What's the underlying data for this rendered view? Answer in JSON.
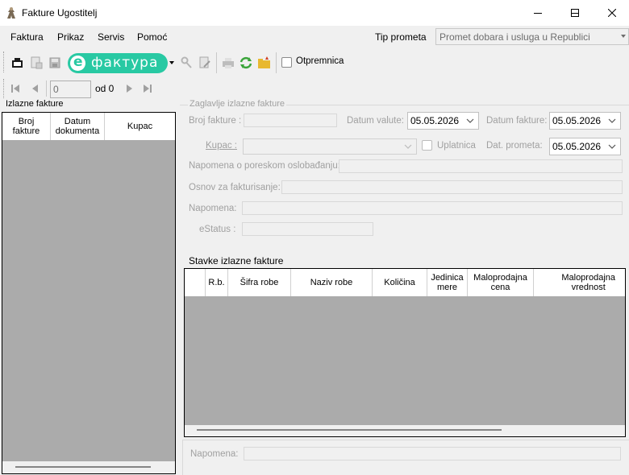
{
  "window": {
    "title": "Fakture Ugostitelj"
  },
  "menu": {
    "items": [
      "Faktura",
      "Prikaz",
      "Servis",
      "Pomoć"
    ]
  },
  "tip_prometa": {
    "label": "Tip prometa",
    "value": "Promet dobara i usluga u Republici"
  },
  "toolbar": {
    "efaktura_label": "фактура",
    "efaktura_e": "e",
    "otpremnica_label": "Otpremnica"
  },
  "navigator": {
    "position": "0",
    "of_label": "od 0"
  },
  "left_panel": {
    "title": "Izlazne fakture",
    "columns": [
      {
        "line1": "Broj",
        "line2": "fakture"
      },
      {
        "line1": "Datum",
        "line2": "dokumenta"
      },
      {
        "line1": "Kupac",
        "line2": ""
      }
    ]
  },
  "header_group": {
    "title": "Zaglavlje izlazne fakture",
    "broj_fakture_label": "Broj fakture :",
    "datum_valute_label": "Datum valute:",
    "datum_valute_value": "05.05.2026",
    "datum_fakture_label": "Datum fakture:",
    "datum_fakture_value": "05.05.2026",
    "kupac_label": "Kupac :",
    "uplatnica_label": "Uplatnica",
    "dat_prometa_label": "Dat. prometa:",
    "dat_prometa_value": "05.05.2026",
    "napomena_poresko_label": "Napomena o poreskom oslobađanju:",
    "osnov_label": "Osnov za fakturisanje:",
    "napomena_label": "Napomena:",
    "estatus_label": "eStatus :"
  },
  "items_panel": {
    "title": "Stavke izlazne fakture",
    "columns": [
      {
        "line1": "",
        "line2": ""
      },
      {
        "line1": "R.b.",
        "line2": ""
      },
      {
        "line1": "Šifra robe",
        "line2": ""
      },
      {
        "line1": "Naziv robe",
        "line2": ""
      },
      {
        "line1": "Količina",
        "line2": ""
      },
      {
        "line1": "Jedinica",
        "line2": "mere"
      },
      {
        "line1": "Maloprodajna",
        "line2": "cena"
      },
      {
        "line1": "Maloprodajna",
        "line2": "vrednost"
      }
    ]
  },
  "footer": {
    "napomena_label": "Napomena:"
  },
  "colors": {
    "efaktura_green": "#28c9a3",
    "grid_bg": "#ababab",
    "disabled_text": "#a0a0a0"
  }
}
